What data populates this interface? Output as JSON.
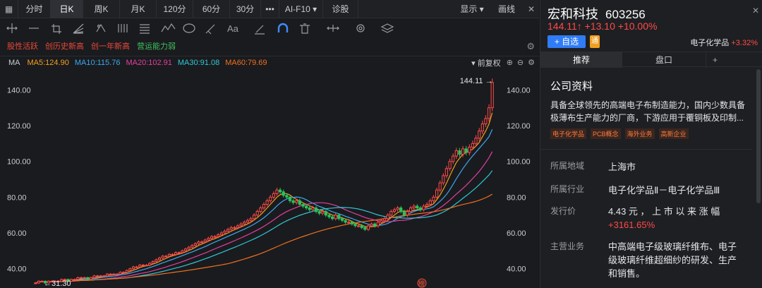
{
  "tabs": {
    "items": [
      {
        "label": "分时",
        "w": 46
      },
      {
        "label": "日K",
        "w": 46,
        "active": true
      },
      {
        "label": "周K",
        "w": 52
      },
      {
        "label": "月K",
        "w": 52
      },
      {
        "label": "120分",
        "w": 52
      },
      {
        "label": "60分",
        "w": 52
      },
      {
        "label": "30分",
        "w": 44
      }
    ],
    "more": "•••",
    "f10": "AI-F10",
    "diag": "诊股",
    "show": "显示",
    "draw": "画线"
  },
  "signals": [
    {
      "text": "股性活跃",
      "color": "#e8483b"
    },
    {
      "text": "创历史新高",
      "color": "#e8483b"
    },
    {
      "text": "创一年新高",
      "color": "#e8483b"
    },
    {
      "text": "营运能力弱",
      "color": "#3fbf5f"
    }
  ],
  "ma": {
    "label": "MA",
    "items": [
      {
        "text": "MA5:124.90",
        "color": "#f0a020"
      },
      {
        "text": "MA10:115.76",
        "color": "#3fa6f0"
      },
      {
        "text": "MA20:102.91",
        "color": "#e040a0"
      },
      {
        "text": "MA30:91.08",
        "color": "#2fc8d8"
      },
      {
        "text": "MA60:79.69",
        "color": "#f07020"
      }
    ],
    "adj": "前复权"
  },
  "chart_data": {
    "type": "candlestick",
    "ylim": [
      30,
      150
    ],
    "y_ticks": [
      40,
      60,
      80,
      100,
      120,
      140
    ],
    "y_tick_labels": [
      "40.00",
      "60.00",
      "80.00",
      "100.00",
      "120.00",
      "140.00"
    ],
    "high_label": "144.11",
    "low_label": "31.30",
    "marker": "榜",
    "closes": [
      32,
      33,
      33,
      32,
      33,
      33,
      33,
      33,
      34,
      34,
      33,
      34,
      34,
      35,
      35,
      35,
      34,
      35,
      36,
      36,
      36,
      36,
      37,
      37,
      37,
      37,
      38,
      38,
      39,
      40,
      41,
      41,
      42,
      42,
      42,
      43,
      44,
      45,
      46,
      47,
      47,
      48,
      48,
      49,
      49,
      50,
      51,
      52,
      53,
      54,
      55,
      55,
      56,
      57,
      58,
      58,
      59,
      60,
      61,
      62,
      63,
      63,
      64,
      65,
      66,
      67,
      68,
      70,
      72,
      74,
      76,
      78,
      80,
      82,
      84,
      83,
      81,
      80,
      78,
      77,
      78,
      76,
      75,
      74,
      73,
      74,
      72,
      71,
      72,
      70,
      69,
      68,
      70,
      68,
      67,
      66,
      66,
      65,
      64,
      64,
      63,
      62,
      64,
      65,
      64,
      66,
      67,
      68,
      70,
      72,
      73,
      74,
      72,
      70,
      72,
      74,
      75,
      74,
      73,
      75,
      76,
      78,
      80,
      84,
      88,
      92,
      96,
      100,
      103,
      106,
      104,
      107,
      105,
      108,
      110,
      113,
      117,
      121,
      124,
      130,
      144.11
    ]
  },
  "stock": {
    "name": "宏和科技",
    "code": "603256",
    "price": "144.11↑",
    "change": "+13.10",
    "pct": "+10.00%",
    "add": "+ 自选",
    "tong": "通",
    "sector": "电子化学品",
    "sector_pct": "+3.32%"
  },
  "rtabs": {
    "rec": "推荐",
    "pankou": "盘口",
    "plus": "+"
  },
  "company": {
    "title": "公司资料",
    "desc1": "具备全球领先的高端电子布制造能力，国内少数具备",
    "desc2": "极薄布生产能力的厂商，下游应用于覆铜板及印制...",
    "tags": [
      "电子化学品",
      "PCB概念",
      "海外业务",
      "高新企业"
    ],
    "region_l": "所属地域",
    "region": "上海市",
    "industry_l": "所属行业",
    "industry": "电子化学品Ⅱ－电子化学品Ⅲ",
    "ipo_l": "发行价",
    "ipo": "4.43 元 ， 上 市 以 来 涨 幅",
    "ipo_pct": "+3161.65%",
    "biz_l": "主营业务",
    "biz1": "中高端电子级玻璃纤维布、电子",
    "biz2": "级玻璃纤维超细纱的研发、生产",
    "biz3": "和销售。"
  }
}
